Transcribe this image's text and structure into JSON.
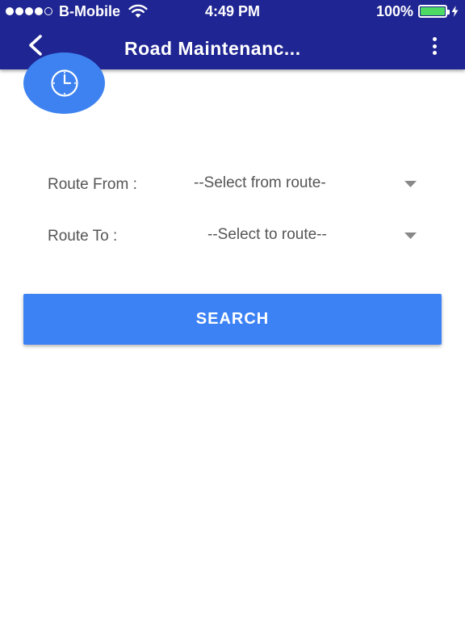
{
  "status_bar": {
    "carrier": "B-Mobile",
    "time": "4:49 PM",
    "battery_percent": "100%",
    "battery_level": 1.0,
    "signal_bars_filled": 4,
    "signal_bars_total": 5,
    "icons": [
      "signal-icon",
      "wifi-icon",
      "battery-icon",
      "charging-icon"
    ]
  },
  "app_bar": {
    "title": "Road Maintenanc...",
    "background": "#1f2592",
    "back_icon": "chevron-left-icon",
    "menu_icon": "more-vert-icon"
  },
  "fab": {
    "icon": "clock-icon",
    "color": "#3d82f0"
  },
  "form": {
    "route_from": {
      "label": "Route From :",
      "selected": "--Select from route-"
    },
    "route_to": {
      "label": "Route To :",
      "selected": "--Select to route--"
    },
    "caret_icon": "caret-down-icon"
  },
  "search_button": {
    "label": "SEARCH",
    "color": "#3d82f5"
  }
}
